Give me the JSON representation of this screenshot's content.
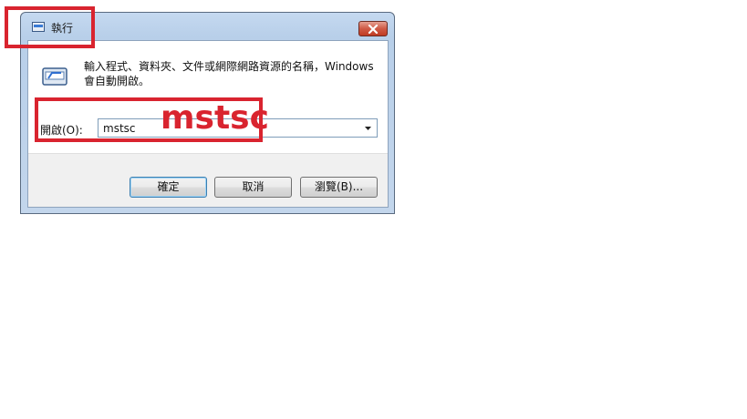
{
  "window": {
    "title": "執行",
    "close_icon": "close-icon",
    "description": "輸入程式、資料夾、文件或網際網路資源的名稱，Windows 會自動開啟。",
    "open_label": "開啟(O):",
    "open_value": "mstsc",
    "buttons": {
      "ok": "確定",
      "cancel": "取消",
      "browse": "瀏覽(B)..."
    }
  },
  "annotation": {
    "text": "mstsc",
    "color": "#d9242f"
  }
}
